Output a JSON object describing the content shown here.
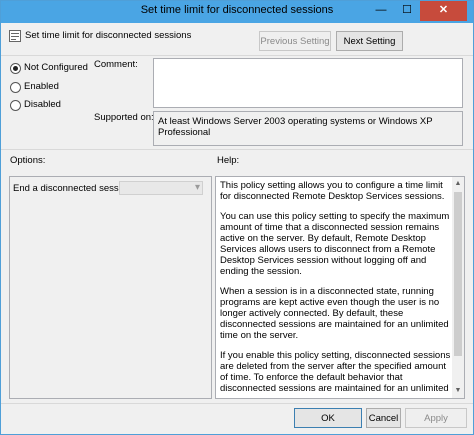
{
  "window": {
    "title": "Set time limit for disconnected sessions",
    "min_glyph": "—",
    "max_glyph": "☐",
    "close_glyph": "✕"
  },
  "header": {
    "setting_name": "Set time limit for disconnected sessions",
    "previous_setting": "Previous Setting",
    "next_setting": "Next Setting"
  },
  "state": {
    "options": [
      {
        "label": "Not Configured",
        "selected": true
      },
      {
        "label": "Enabled",
        "selected": false
      },
      {
        "label": "Disabled",
        "selected": false
      }
    ]
  },
  "comment": {
    "label": "Comment:",
    "value": ""
  },
  "supported_on": {
    "label": "Supported on:",
    "value": "At least Windows Server 2003 operating systems or Windows XP Professional"
  },
  "options_panel": {
    "title": "Options:",
    "field_label": "End a disconnected session",
    "field_value": ""
  },
  "help_panel": {
    "title": "Help:",
    "paragraphs": [
      "This policy setting allows you to configure a time limit for disconnected Remote Desktop Services sessions.",
      "You can use this policy setting to specify the maximum amount of time that a disconnected session remains active on the server. By default, Remote Desktop Services allows users to disconnect from a Remote Desktop Services session without logging off and ending the session.",
      "When a session is in a disconnected state, running programs are kept active even though the user is no longer actively connected. By default, these disconnected sessions are maintained for an unlimited time on the server.",
      "If you enable this policy setting, disconnected sessions are deleted from the server after the specified amount of time. To enforce the default behavior that disconnected sessions are maintained for an unlimited time, select Never. If you have a console session, disconnected session time limits do not apply."
    ]
  },
  "footer": {
    "ok": "OK",
    "cancel": "Cancel",
    "apply": "Apply"
  },
  "icons": {
    "setting_icon": "policy-setting-icon",
    "scroll_up": "▲",
    "scroll_down": "▼",
    "dropdown": "▾"
  },
  "colors": {
    "titlebar": "#4aa5e4",
    "close": "#c74b3c"
  }
}
